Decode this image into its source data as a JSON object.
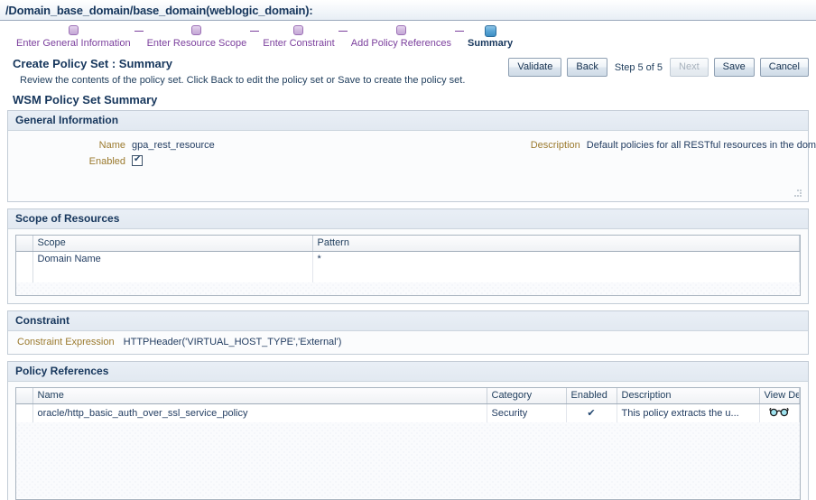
{
  "titlebar": {
    "breadcrumb": "/Domain_base_domain/base_domain(weblogic_domain):"
  },
  "train": {
    "steps": [
      {
        "label": "Enter General Information",
        "state": "done"
      },
      {
        "label": "Enter Resource Scope",
        "state": "done"
      },
      {
        "label": "Enter Constraint",
        "state": "done"
      },
      {
        "label": "Add Policy References",
        "state": "done"
      },
      {
        "label": "Summary",
        "state": "active"
      }
    ]
  },
  "page": {
    "title": "Create Policy Set : Summary",
    "instruction": "Review the contents of the policy set. Click Back to edit the policy set or Save to create the policy set.",
    "section_title": "WSM Policy Set Summary"
  },
  "actions": {
    "validate": "Validate",
    "back": "Back",
    "step_text": "Step 5 of 5",
    "next": "Next",
    "save": "Save",
    "cancel": "Cancel"
  },
  "general_information": {
    "header": "General Information",
    "name_label": "Name",
    "name_value": "gpa_rest_resource",
    "enabled_label": "Enabled",
    "enabled_checked": true,
    "description_label": "Description",
    "description_value": "Default policies for all RESTful resources in the domain."
  },
  "scope_of_resources": {
    "header": "Scope of Resources",
    "columns": [
      "Scope",
      "Pattern"
    ],
    "rows": [
      {
        "scope": "Domain Name",
        "pattern": "*"
      }
    ]
  },
  "constraint": {
    "header": "Constraint",
    "expression_label": "Constraint Expression",
    "expression_value": "HTTPHeader('VIRTUAL_HOST_TYPE','External')"
  },
  "policy_references": {
    "header": "Policy References",
    "columns": [
      "Name",
      "Category",
      "Enabled",
      "Description",
      "View Detail"
    ],
    "rows": [
      {
        "name": "oracle/http_basic_auth_over_ssl_service_policy",
        "category": "Security",
        "enabled": true,
        "description": "This policy extracts the u...",
        "view_detail_icon": "glasses-icon"
      }
    ]
  },
  "colors": {
    "accent_purple": "#7b3f9d",
    "heading_navy": "#16365c",
    "label_olive": "#9b7a2e",
    "active_blue": "#3f8fc4"
  }
}
